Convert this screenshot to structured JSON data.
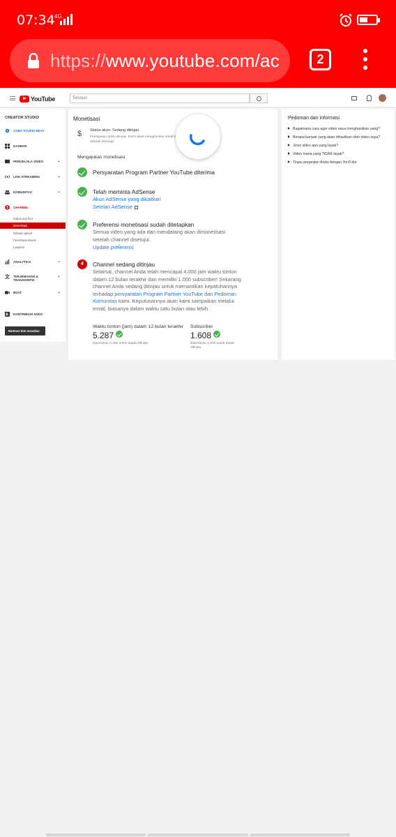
{
  "status_bar": {
    "time": "07:34",
    "network": "4G"
  },
  "url_bar": {
    "url_dim": "https://",
    "url_main": "www.youtube.com/ac",
    "tab_count": "2"
  },
  "yt_header": {
    "logo_text": "YouTube",
    "search_placeholder": "Telusuri"
  },
  "sidebar": {
    "title": "CREATOR STUDIO",
    "try_beta": "COBA STUDIO BETA",
    "dashboard": "DASBOR",
    "video_manager": "PENGELOLA VIDEO",
    "live_streaming": "LIVE STREAMING",
    "community": "KOMUNITAS",
    "channel": "CHANNEL",
    "channel_subs": [
      "Status dan fitur",
      "Monetisasi",
      "Default upload",
      "Pencitraan Merek",
      "Lanjutan"
    ],
    "analytics": "ANALYTICS",
    "translations": "TERJEMAHAN & TRANSKRIPSI",
    "create": "BUAT",
    "contributions": "KONTRIBUSI ANDA",
    "feedback_button": "Bantuan dan masukan"
  },
  "main": {
    "heading": "Monetisasi",
    "account_status": "Status akun: Sedang ditinjau",
    "account_desc": "Peninjauan telah dimulai. Kami akan mengirimkan email kepada Anda setelah disetujui.",
    "section_heading": "Mengajukan monetisasi",
    "step1_title": "Persyaratan Program Partner YouTube diterima",
    "step2_title": "Telah meminta AdSense",
    "step2_link1": "Akun AdSense yang dikaitkan",
    "step2_link2": "Setelan AdSense",
    "step3_title": "Preferensi monetisasi sudah ditetapkan",
    "step3_desc": "Semua video yang ada dan mendatang akan dimonetisasi setelah channel disetujui.",
    "step3_link": "Update preferensi",
    "step4_number": "4",
    "step4_title": "Channel sedang ditinjau",
    "step4_desc_a": "Selamat, channel Anda telah mencapai 4.000 jam waktu tonton dalam 12 bulan terakhir dan memiliki 1.000 subscriber! Sekarang channel Anda sedang ditinjau untuk memastikan kepatuhannya terhadap ",
    "step4_link_a": "persyaratan Program Partner YouTube",
    "step4_desc_b": " dan ",
    "step4_link_b": "Pedoman Komunitas",
    "step4_desc_c": " kami. Keputusannya akan kami sampaikan melalui email, biasanya dalam waktu satu bulan atau lebih.",
    "watch_label": "Waktu tonton (jam) dalam 12 bulan terakhir",
    "watch_value": "5.287",
    "watch_note": "Diperlukan 4.000 untuk dapat ditinjau",
    "subs_label": "Subscriber",
    "subs_value": "1.608",
    "subs_note": "Diperlukan 1.000 untuk dapat ditinjau"
  },
  "right_panel": {
    "heading": "Pedoman dan informasi",
    "items": [
      "Bagaimana cara agar video saya menghasilkan uang?",
      "Berapa banyak yang akan dihasilkan oleh video saya?",
      "Jenis video apa yang layak?",
      "Video mana yang TIDAK layak?",
      "Tinjau perjanjian Anda dengan YouTube"
    ]
  },
  "colors": {
    "brand_red": "#ff0000",
    "link_blue": "#1a73e8",
    "success_green": "#4caf50",
    "channel_red": "#cc0000"
  }
}
